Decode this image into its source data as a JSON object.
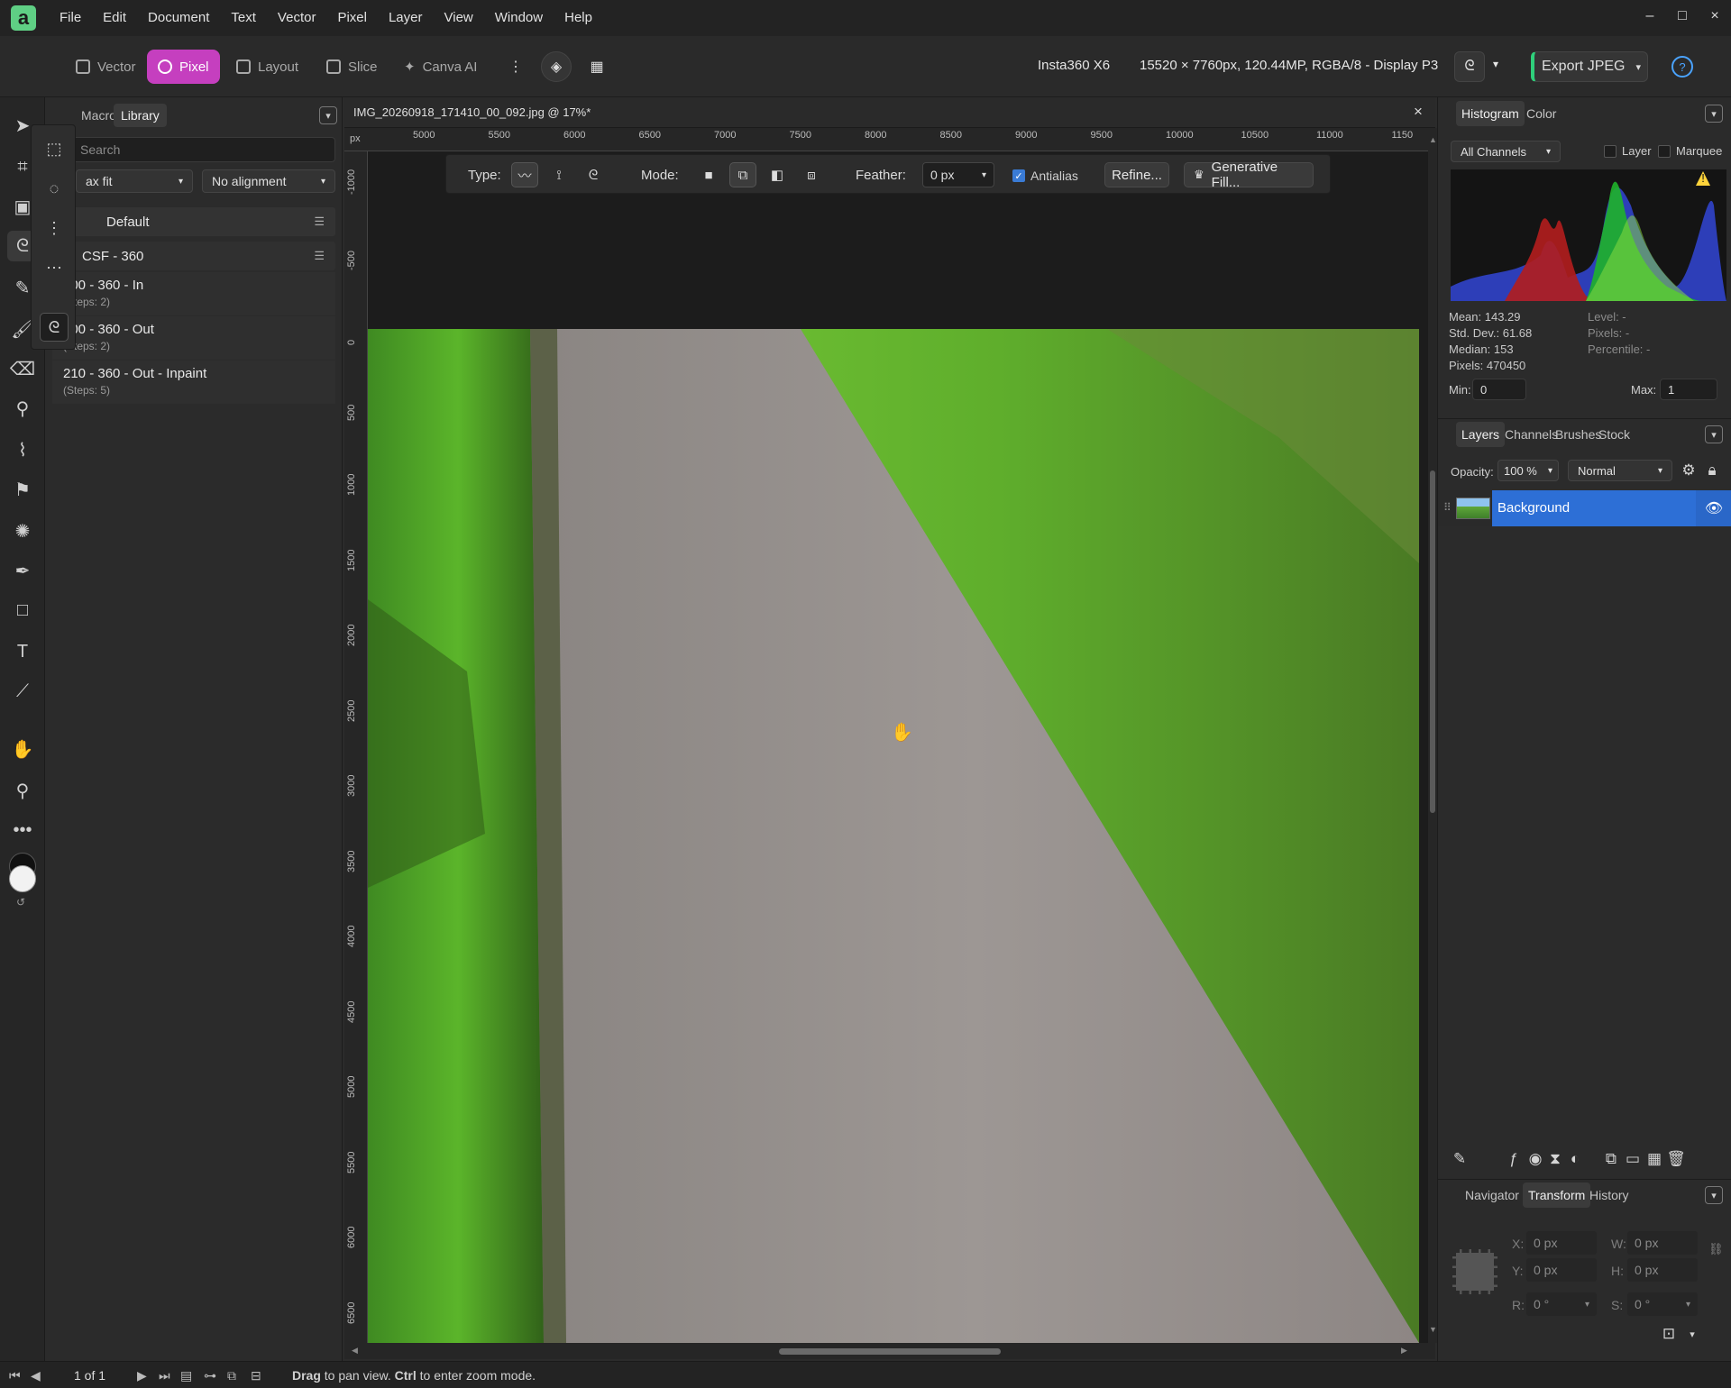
{
  "menu": [
    "File",
    "Edit",
    "Document",
    "Text",
    "Vector",
    "Pixel",
    "Layer",
    "View",
    "Window",
    "Help"
  ],
  "app_logo": "a",
  "window_controls": [
    "–",
    "□",
    "×"
  ],
  "personas": [
    "Vector",
    "Pixel",
    "Layout",
    "Slice",
    "Canva AI"
  ],
  "toolbar": {
    "camera": "Insta360 X6",
    "doc_info": "15520 × 7760px, 120.44MP, RGBA/8 - Display P3",
    "export": "Export JPEG",
    "help": "?"
  },
  "left_panel": {
    "tabs": [
      "Macro",
      "Library"
    ],
    "search_placeholder": "Search",
    "fit_select": "ax fit",
    "align_select": "No alignment",
    "group_default": "Default",
    "group_csf": "CSF - 360",
    "macros": [
      {
        "name": "100 - 360 - In",
        "steps": "(Steps: 2)"
      },
      {
        "name": "200 - 360 - Out",
        "steps": "(Steps: 2)"
      },
      {
        "name": "210 - 360 - Out - Inpaint",
        "steps": "(Steps: 5)"
      }
    ]
  },
  "document": {
    "tab_title": "IMG_20260918_171410_00_092.jpg @ 17%*",
    "ruler_unit": "px",
    "ruler_top": [
      "5000",
      "5500",
      "6000",
      "6500",
      "7000",
      "7500",
      "8000",
      "8500",
      "9000",
      "9500",
      "10000",
      "10500",
      "11000",
      "1150"
    ],
    "ruler_left": [
      "-1000",
      "-500",
      "0",
      "500",
      "1000",
      "1500",
      "2000",
      "2500",
      "3000",
      "3500",
      "4000",
      "4500",
      "5000",
      "5500",
      "6000",
      "6500"
    ]
  },
  "context_toolbar": {
    "type_label": "Type:",
    "mode_label": "Mode:",
    "feather_label": "Feather:",
    "feather_value": "0 px",
    "antialias": "Antialias",
    "refine": "Refine...",
    "generative_fill": "Generative Fill..."
  },
  "histogram": {
    "tabs": [
      "Histogram",
      "Color"
    ],
    "channel": "All Channels",
    "layer_label": "Layer",
    "marquee_label": "Marquee",
    "mean": "Mean: 143.29",
    "std_dev": "Std. Dev.: 61.68",
    "median": "Median: 153",
    "pixels": "Pixels: 470450",
    "level": "Level: -",
    "pixels_sel": "Pixels: -",
    "percentile": "Percentile: -",
    "min_label": "Min:",
    "min_value": "0",
    "max_label": "Max:",
    "max_value": "1",
    "warning": "!"
  },
  "layers": {
    "tabs": [
      "Layers",
      "Channels",
      "Brushes",
      "Stock"
    ],
    "opacity_label": "Opacity:",
    "opacity_value": "100 %",
    "blend_mode": "Normal",
    "layer_name": "Background"
  },
  "transform": {
    "tabs": [
      "Navigator",
      "Transform",
      "History"
    ],
    "x_label": "X:",
    "x_value": "0 px",
    "y_label": "Y:",
    "y_value": "0 px",
    "w_label": "W:",
    "w_value": "0 px",
    "h_label": "H:",
    "h_value": "0 px",
    "r_label": "R:",
    "r_value": "0 °",
    "s_label": "S:",
    "s_value": "0 °"
  },
  "statusbar": {
    "page": "1 of 1",
    "hint_bold1": "Drag",
    "hint1": " to pan view. ",
    "hint_bold2": "Ctrl",
    "hint2": " to enter zoom mode."
  }
}
